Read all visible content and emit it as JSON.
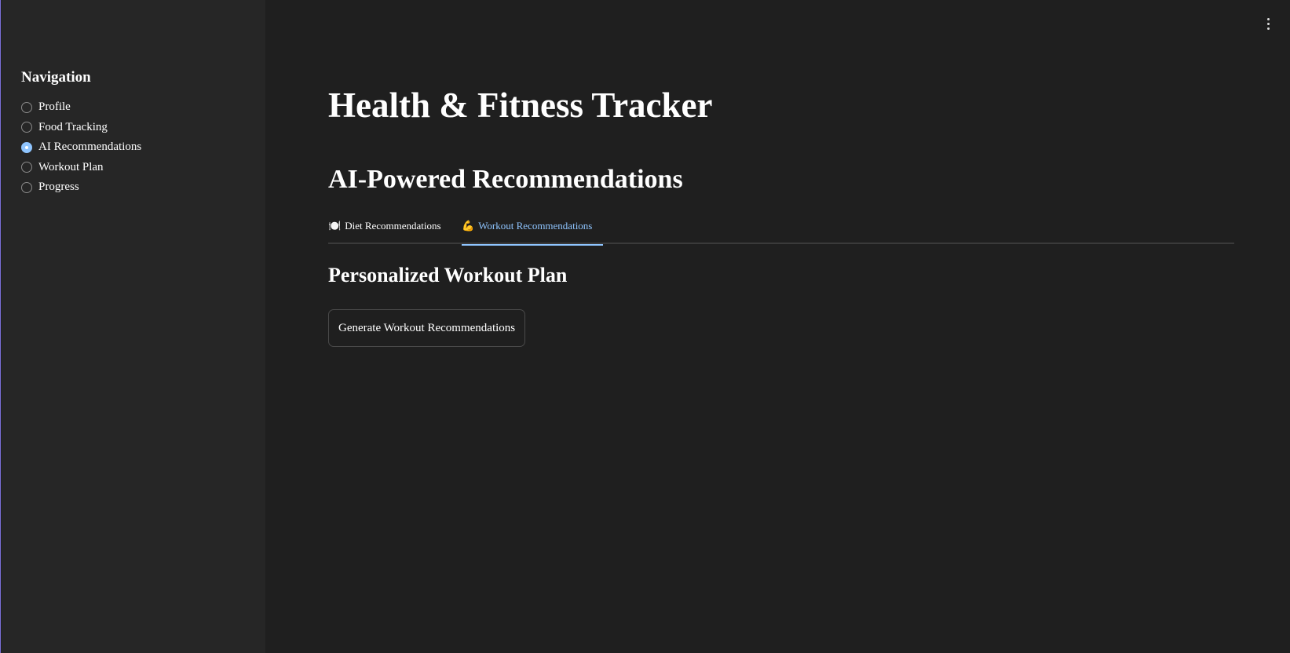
{
  "sidebar": {
    "title": "Navigation",
    "items": [
      {
        "label": "Profile",
        "selected": false
      },
      {
        "label": "Food Tracking",
        "selected": false
      },
      {
        "label": "AI Recommendations",
        "selected": true
      },
      {
        "label": "Workout Plan",
        "selected": false
      },
      {
        "label": "Progress",
        "selected": false
      }
    ]
  },
  "header": {
    "menu_icon": "vertical-ellipsis-icon"
  },
  "main": {
    "page_title": "Health & Fitness Tracker",
    "section_title": "AI-Powered Recommendations",
    "tabs": [
      {
        "emoji": "🍽️",
        "label": "Diet Recommendations",
        "active": false
      },
      {
        "emoji": "💪",
        "label": "Workout Recommendations",
        "active": true
      }
    ],
    "sub_title": "Personalized Workout Plan",
    "generate_button": "Generate Workout Recommendations"
  },
  "colors": {
    "background": "#1f1f1f",
    "sidebar_background": "#262626",
    "accent": "#8fc5ff",
    "text": "#ffffff"
  }
}
